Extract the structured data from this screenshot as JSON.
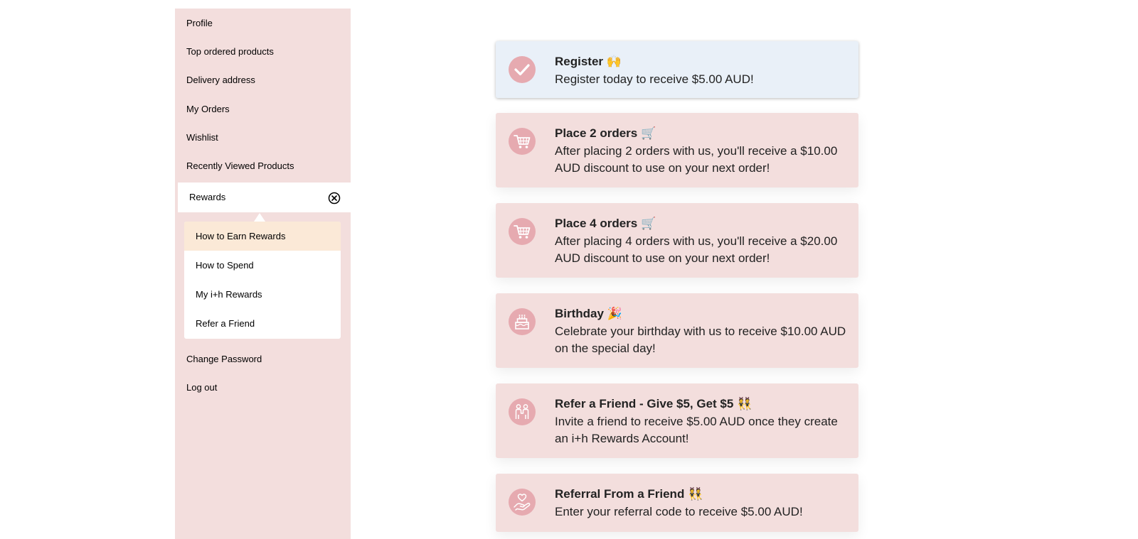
{
  "sidebar": {
    "items": [
      {
        "label": "Profile"
      },
      {
        "label": "Top ordered products"
      },
      {
        "label": "Delivery address"
      },
      {
        "label": "My Orders"
      },
      {
        "label": "Wishlist"
      },
      {
        "label": "Recently Viewed Products"
      },
      {
        "label": "Rewards",
        "active": true,
        "icon": "close-circle-icon"
      },
      {
        "label": "Change Password"
      },
      {
        "label": "Log out"
      }
    ],
    "submenu": [
      {
        "label": "How to Earn Rewards",
        "selected": true
      },
      {
        "label": "How to Spend"
      },
      {
        "label": "My i+h Rewards"
      },
      {
        "label": "Refer a Friend"
      }
    ]
  },
  "rewards": [
    {
      "title": "Register 🙌",
      "description": "Register today to receive $5.00 AUD!",
      "icon": "checkmark-icon",
      "completed": true
    },
    {
      "title": "Place 2 orders 🛒",
      "description": "After placing 2 orders with us, you'll receive a $10.00 AUD discount to use on your next order!",
      "icon": "shopping-cart-icon"
    },
    {
      "title": "Place 4 orders 🛒",
      "description": "After placing 4 orders with us, you'll receive a $20.00 AUD discount to use on your next order!",
      "icon": "shopping-cart-icon"
    },
    {
      "title": "Birthday 🎉",
      "description": "Celebrate your birthday with us to receive $10.00 AUD on the special day!",
      "icon": "birthday-cake-icon"
    },
    {
      "title": "Refer a Friend - Give $5, Get $5 👯",
      "description": "Invite a friend to receive $5.00 AUD once they create an i+h Rewards Account!",
      "icon": "friends-icon"
    },
    {
      "title": "Referral From a Friend 👯",
      "description": "Enter your referral code to receive $5.00 AUD!",
      "icon": "heart-in-hand-icon"
    }
  ],
  "colors": {
    "sidebar_bg": "#f3dedd",
    "selected_submenu_bg": "#fbe9d7",
    "completed_card_bg": "#e9f0f8",
    "card_bg": "#f3dedd",
    "icon_circle": "#e6aab0"
  }
}
